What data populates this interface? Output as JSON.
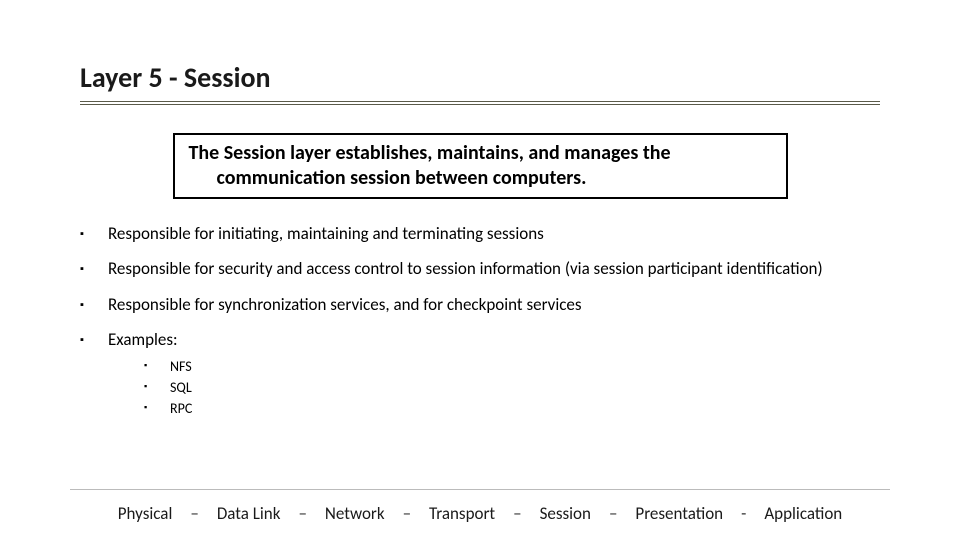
{
  "title": "Layer 5 - Session",
  "definition": {
    "line1": "The Session layer establishes, maintains, and manages the",
    "line2": "communication session between computers."
  },
  "bullets": [
    "Responsible for initiating, maintaining and terminating sessions",
    "Responsible for security and access control to session information (via session participant identification)",
    "Responsible for synchronization services, and for checkpoint services",
    "Examples:"
  ],
  "examples": [
    "NFS",
    "SQL",
    "RPC"
  ],
  "footer": {
    "items": [
      "Physical",
      "Data Link",
      "Network",
      "Transport",
      "Session",
      "Presentation",
      "Application"
    ],
    "sep1": "–",
    "sep2": "-"
  }
}
